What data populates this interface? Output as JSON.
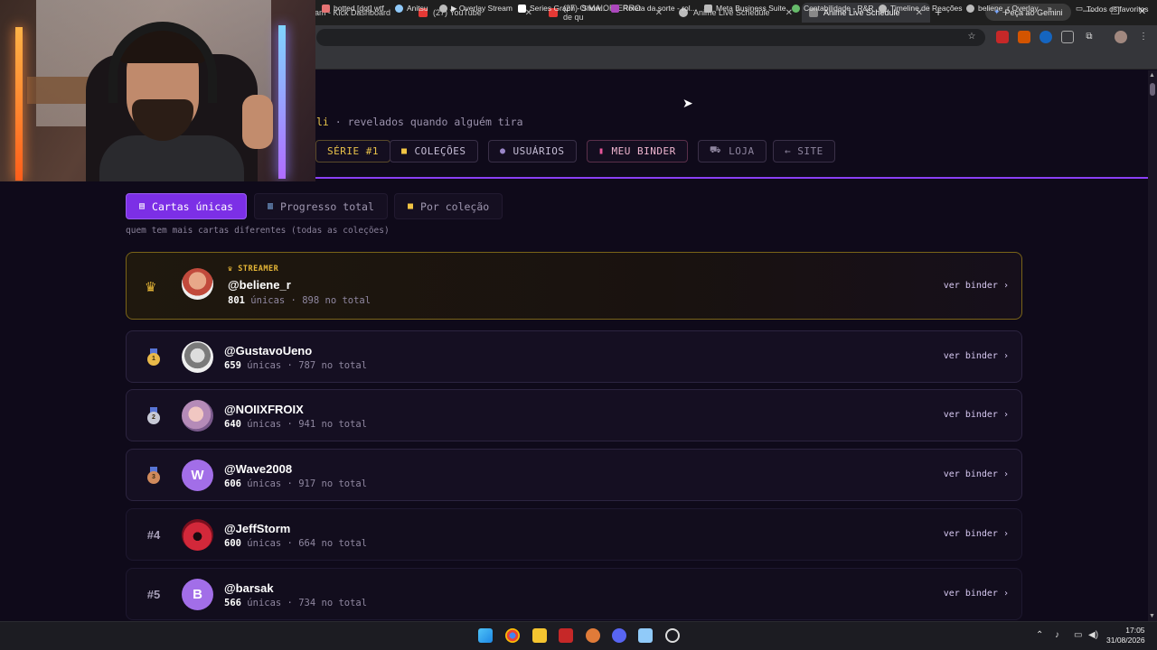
{
  "browser": {
    "tabs": [
      {
        "label": "am - Kick Dashboard",
        "active": false
      },
      {
        "label": "(27) YouTube",
        "active": false
      },
      {
        "label": "(27) O MAIOR ERRO de qu",
        "active": false
      },
      {
        "label": "Anime Live Schedule",
        "active": false
      },
      {
        "label": "Anime Live Schedule",
        "active": true
      }
    ],
    "gemini_label": "Peça ao Gemini",
    "bookmarks": [
      "botted [dot] wtf",
      "Anitsu",
      "▶ Overlay Stream",
      "Series Graph - Show...",
      "Roleta da sorte - rol...",
      "Meta Business Suite",
      "Contabilidade - R&R",
      "Timeline de Reações",
      "beliene_r Overlay"
    ],
    "bookmarks_more": "»",
    "all_favorites": "Todos os favoritos"
  },
  "header": {
    "subtitle_accent": "li",
    "subtitle_rest": " · revelados quando alguém tira"
  },
  "nav": [
    {
      "label": "SÉRIE #1",
      "icon": ""
    },
    {
      "label": "COLEÇÕES",
      "icon": "folder-icon"
    },
    {
      "label": "USUÁRIOS",
      "icon": "user-icon"
    },
    {
      "label": "MEU BINDER",
      "icon": "binder-icon"
    },
    {
      "label": "LOJA",
      "icon": "cart-icon"
    },
    {
      "label": "← SITE",
      "icon": ""
    }
  ],
  "segments": [
    {
      "label": "Cartas únicas",
      "active": true
    },
    {
      "label": "Progresso total",
      "active": false
    },
    {
      "label": "Por coleção",
      "active": false
    }
  ],
  "hint": "quem tem mais cartas diferentes (todas as coleções)",
  "leaderboard": {
    "streamer_tag": "STREAMER",
    "unique_label": "únicas",
    "total_label": "no total",
    "ver_binder": "ver binder ›",
    "rows": [
      {
        "rank": "",
        "badge": "crown",
        "user": "@beliene_r",
        "unique": "801",
        "total": "898",
        "avatar_letter": ""
      },
      {
        "rank": "",
        "badge": "1",
        "user": "@GustavoUeno",
        "unique": "659",
        "total": "787",
        "avatar_letter": ""
      },
      {
        "rank": "",
        "badge": "2",
        "user": "@NOIIXFROIX",
        "unique": "640",
        "total": "941",
        "avatar_letter": ""
      },
      {
        "rank": "",
        "badge": "3",
        "user": "@Wave2008",
        "unique": "606",
        "total": "917",
        "avatar_letter": "W"
      },
      {
        "rank": "#4",
        "badge": "",
        "user": "@JeffStorm",
        "unique": "600",
        "total": "664",
        "avatar_letter": ""
      },
      {
        "rank": "#5",
        "badge": "",
        "user": "@barsak",
        "unique": "566",
        "total": "734",
        "avatar_letter": "B"
      }
    ]
  },
  "taskbar": {
    "time": "17:05",
    "date": "31/08/2026"
  },
  "colors": {
    "accent": "#7c2fe6",
    "gold": "#e6b637",
    "background": "#0f0a1a"
  }
}
